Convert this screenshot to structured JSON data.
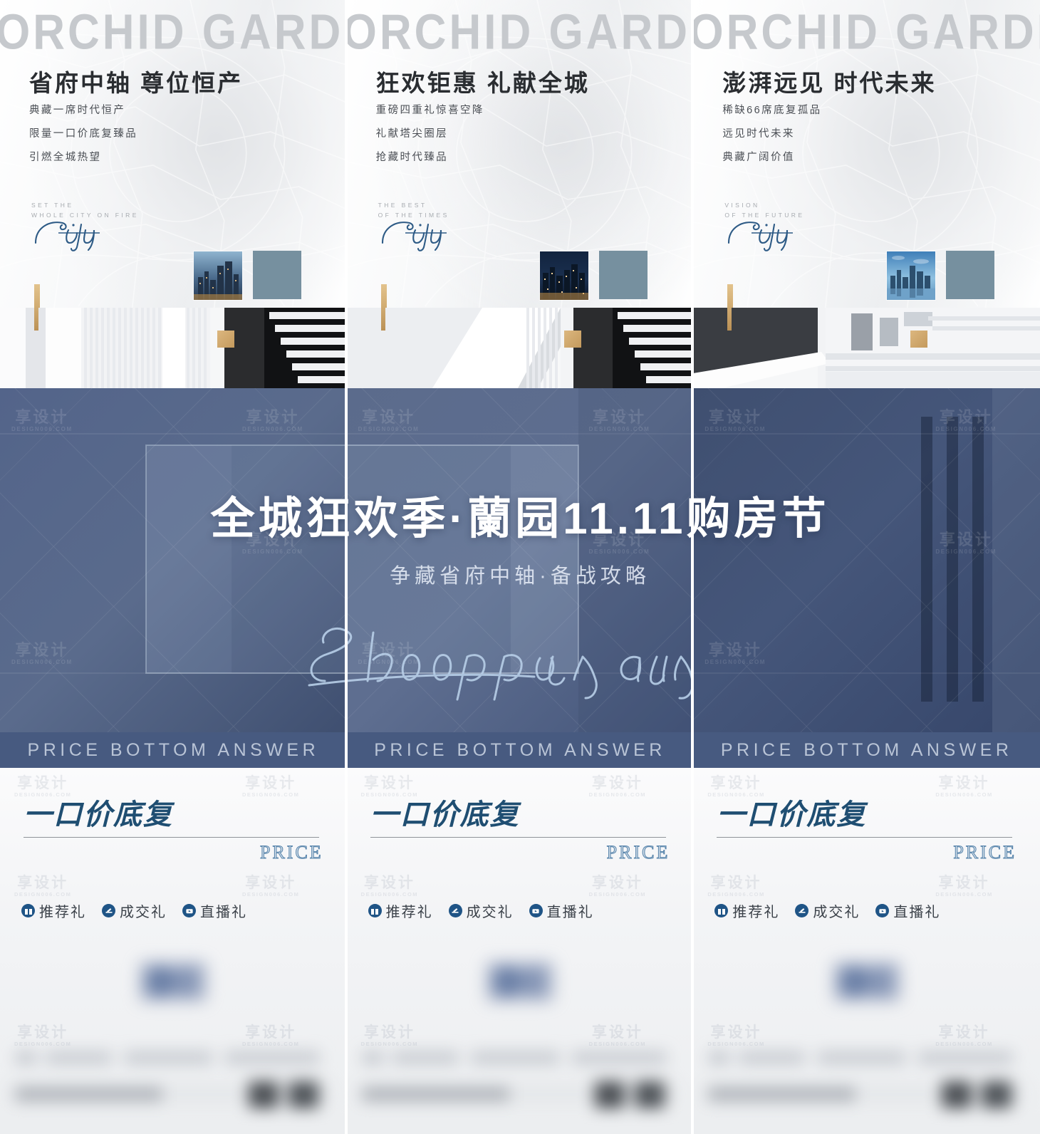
{
  "meta": {
    "brand_en": "ORCHID GARDEN",
    "watermark_cn": "享设计",
    "watermark_en": "DESIGN006.COM",
    "script_word": "City",
    "accent_blue": "#1f4e72",
    "band_blue": "#475a80",
    "hero_blue": "#55678a",
    "gold": "#c8a063",
    "swatch_blue": "#76909f"
  },
  "panels": [
    {
      "brand": "ORCHID GARDEN",
      "headline": "省府中轴  尊位恒产",
      "bullets": [
        "典藏一席时代恒产",
        "限量一口价底复臻品",
        "引燃全城热望"
      ],
      "en_line1": "SET THE",
      "en_line2": "WHOLE CITY ON FIRE",
      "script": "City",
      "thumb_alt": "city-skyline-dusk"
    },
    {
      "brand": "ORCHID GARDEN",
      "headline": "狂欢钜惠  礼献全城",
      "bullets": [
        "重磅四重礼惊喜空降",
        "礼献塔尖圈层",
        "抢藏时代臻品"
      ],
      "en_line1": "THE BEST",
      "en_line2": "OF THE TIMES",
      "script": "City",
      "thumb_alt": "city-skyline-night"
    },
    {
      "brand": "ORCHID GARDEN",
      "headline": "澎湃远见  时代未来",
      "bullets": [
        "稀缺66席底复孤品",
        "远见时代未来",
        "典藏广阔价值"
      ],
      "en_line1": "VISION",
      "en_line2": "OF THE FUTURE",
      "script": "City",
      "thumb_alt": "city-skyline-day"
    }
  ],
  "hero_banner": {
    "title": "全城狂欢季·蘭园11.11购房节",
    "subtitle": "争藏省府中轴·备战攻略",
    "script": "Shopping day"
  },
  "answer_bar": {
    "label": "PRICE BOTTOM ANSWER"
  },
  "price_block": {
    "title_cn": "一口价底复",
    "title_en": "PRICE",
    "gifts": [
      {
        "label": "推荐礼",
        "icon": "gift-icon"
      },
      {
        "label": "成交礼",
        "icon": "gavel-icon"
      },
      {
        "label": "直播礼",
        "icon": "live-video-icon"
      }
    ]
  }
}
